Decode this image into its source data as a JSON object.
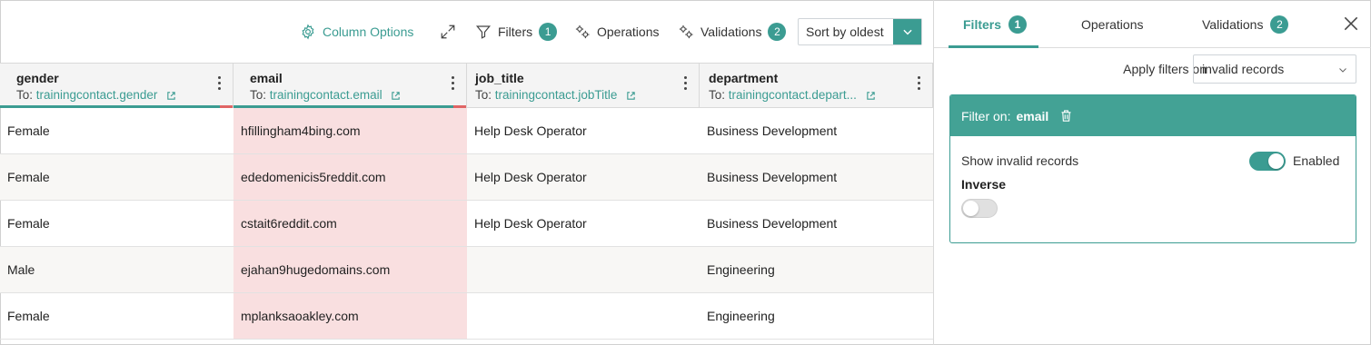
{
  "toolbar": {
    "column_options": "Column Options",
    "filters": "Filters",
    "filters_count": "1",
    "operations": "Operations",
    "validations": "Validations",
    "validations_count": "2",
    "sort": "Sort by oldest"
  },
  "columns": [
    {
      "name": "gender",
      "to_prefix": "To:",
      "target": "trainingcontact.gender"
    },
    {
      "name": "email",
      "to_prefix": "To:",
      "target": "trainingcontact.email"
    },
    {
      "name": "job_title",
      "to_prefix": "To:",
      "target": "trainingcontact.jobTitle"
    },
    {
      "name": "department",
      "to_prefix": "To:",
      "target": "trainingcontact.depart..."
    }
  ],
  "rows": [
    {
      "gender": "Female",
      "email": "hfillingham4bing.com",
      "job_title": "Help Desk Operator",
      "department": "Business Development"
    },
    {
      "gender": "Female",
      "email": "ededomenicis5reddit.com",
      "job_title": "Help Desk Operator",
      "department": "Business Development"
    },
    {
      "gender": "Female",
      "email": "cstait6reddit.com",
      "job_title": "Help Desk Operator",
      "department": "Business Development"
    },
    {
      "gender": "Male",
      "email": "ejahan9hugedomains.com",
      "job_title": "",
      "department": "Engineering"
    },
    {
      "gender": "Female",
      "email": "mplanksaoakley.com",
      "job_title": "",
      "department": "Engineering"
    }
  ],
  "panel": {
    "tabs": [
      {
        "label": "Filters",
        "count": "1"
      },
      {
        "label": "Operations",
        "count": ""
      },
      {
        "label": "Validations",
        "count": "2"
      }
    ],
    "apply_label": "Apply filters on",
    "apply_value": "invalid records",
    "filter_title_prefix": "Filter on:",
    "filter_field": "email",
    "show_invalid_label": "Show invalid records",
    "enabled_label": "Enabled",
    "inverse_label": "Inverse"
  },
  "colors": {
    "accent": "#3b9c92",
    "error_bg": "#f9dfe0",
    "error_line": "#e06565"
  }
}
